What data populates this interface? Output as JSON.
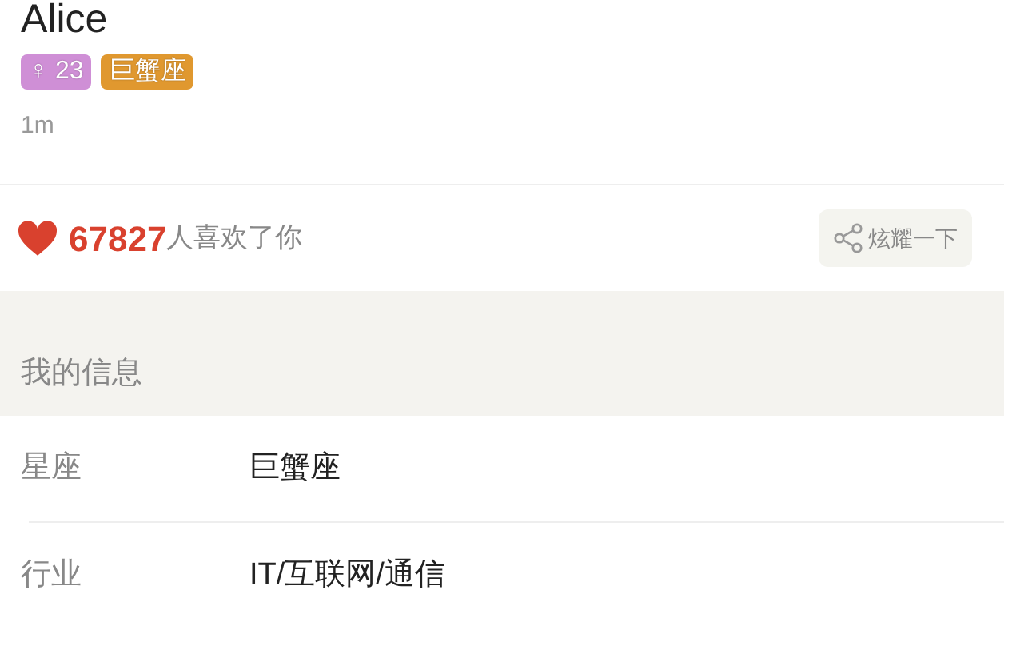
{
  "profile": {
    "name": "Alice",
    "tags": [
      {
        "text": "♀ 23",
        "color": "#cf8fd6"
      },
      {
        "text": "巨蟹座",
        "color": "#e0982f"
      }
    ],
    "last_seen": "1m"
  },
  "likes": {
    "count": "67827",
    "text": "人喜欢了你",
    "share_button": "炫耀一下"
  },
  "section": {
    "title": "我的信息"
  },
  "info_rows": [
    {
      "label": "星座",
      "value": "巨蟹座"
    },
    {
      "label": "行业",
      "value": "IT/互联网/通信"
    }
  ]
}
